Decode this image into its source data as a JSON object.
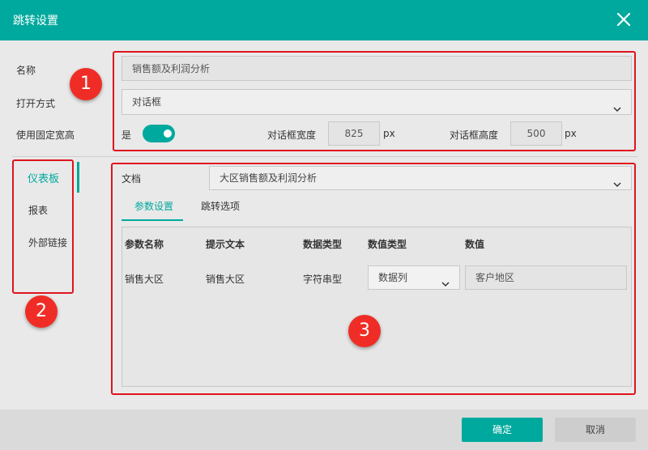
{
  "dialog": {
    "title": "跳转设置"
  },
  "form": {
    "name_label": "名称",
    "name_value": "销售额及利润分析",
    "open_label": "打开方式",
    "open_value": "对话框",
    "fixed_label": "使用固定宽高",
    "fixed_value": "是",
    "fixed_on": true,
    "width_label": "对话框宽度",
    "width_value": "825",
    "width_unit": "px",
    "height_label": "对话框高度",
    "height_value": "500",
    "height_unit": "px"
  },
  "nav": {
    "items": [
      "仪表板",
      "报表",
      "外部链接"
    ],
    "active_index": 0
  },
  "doc": {
    "label": "文档",
    "value": "大区销售额及利润分析"
  },
  "tabs": {
    "items": [
      "参数设置",
      "跳转选项"
    ],
    "active_index": 0
  },
  "table": {
    "headers": [
      "参数名称",
      "提示文本",
      "数据类型",
      "数值类型",
      "数值"
    ],
    "rows": [
      {
        "name": "销售大区",
        "hint": "销售大区",
        "data_type": "字符串型",
        "value_type": "数据列",
        "value": "客户地区"
      }
    ]
  },
  "badges": [
    "1",
    "2",
    "3"
  ],
  "footer": {
    "ok_label": "确定",
    "cancel_label": "取消"
  },
  "colors": {
    "accent": "#00a99d",
    "annotation_red": "#e0141e",
    "badge_red": "#ef2d26"
  },
  "icons": {
    "close": "close-icon",
    "dropdown": "chevron-down-icon"
  }
}
